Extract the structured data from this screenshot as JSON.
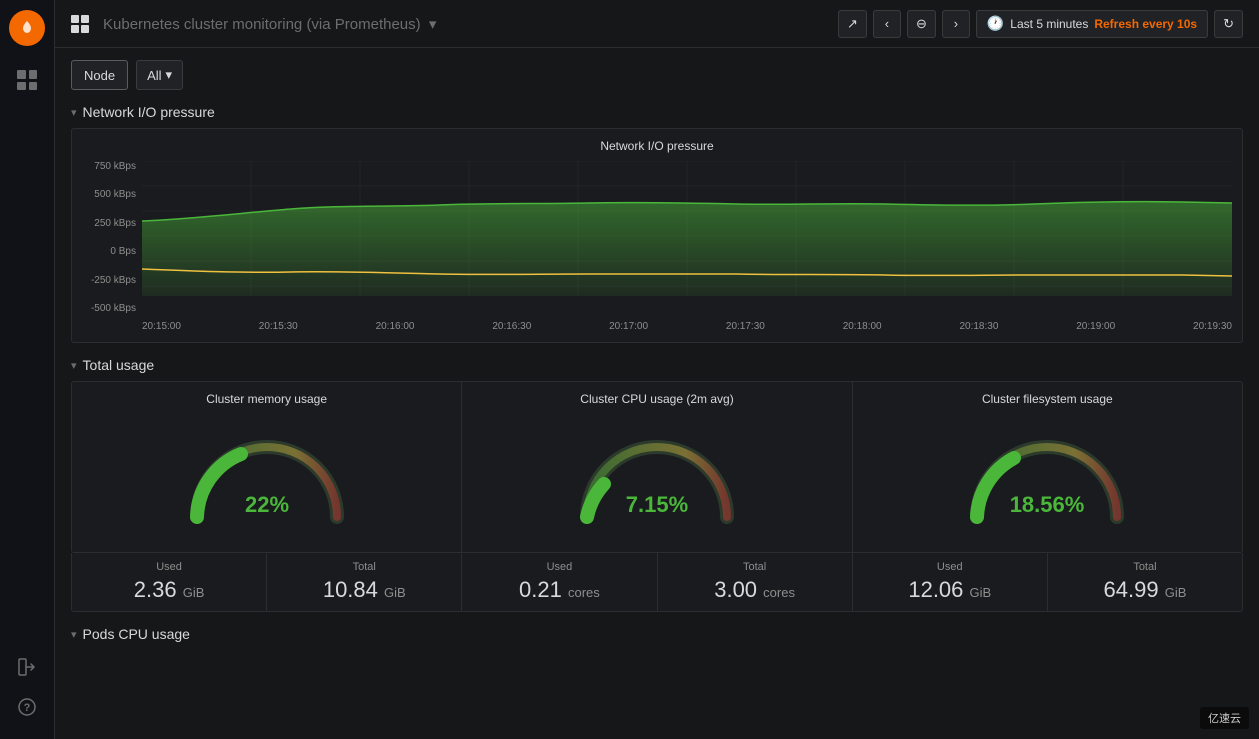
{
  "sidebar": {
    "logo": "🔥",
    "items": []
  },
  "topbar": {
    "title": "Kubernetes cluster monitoring (via Prometheus)",
    "title_suffix": "▾",
    "share_icon": "↗",
    "back_icon": "‹",
    "zoom_out_icon": "⊖",
    "forward_icon": "›",
    "time_range": "Last 5 minutes",
    "refresh_label": "Refresh every 10s",
    "sync_icon": "↻"
  },
  "filters": {
    "node_label": "Node",
    "all_label": "All",
    "all_suffix": "▾"
  },
  "network_section": {
    "collapse_icon": "▾",
    "title": "Network I/O pressure",
    "chart_title": "Network I/O pressure",
    "y_labels": [
      "750 kBps",
      "500 kBps",
      "250 kBps",
      "0 Bps",
      "-250 kBps",
      "-500 kBps"
    ],
    "x_labels": [
      "20:15:00",
      "20:15:30",
      "20:16:00",
      "20:16:30",
      "20:17:00",
      "20:17:30",
      "20:18:00",
      "20:18:30",
      "20:19:00",
      "20:19:30"
    ]
  },
  "total_section": {
    "collapse_icon": "▾",
    "title": "Total usage",
    "gauges": [
      {
        "title": "Cluster memory usage",
        "percent": "22%",
        "color": "#4ab73a"
      },
      {
        "title": "Cluster CPU usage (2m avg)",
        "percent": "7.15%",
        "color": "#4ab73a"
      },
      {
        "title": "Cluster filesystem usage",
        "percent": "18.56%",
        "color": "#4ab73a"
      }
    ],
    "stats": [
      {
        "label": "Used",
        "value": "2.36",
        "unit": "GiB"
      },
      {
        "label": "Total",
        "value": "10.84",
        "unit": "GiB"
      },
      {
        "label": "Used",
        "value": "0.21",
        "unit": "cores"
      },
      {
        "label": "Total",
        "value": "3.00",
        "unit": "cores"
      },
      {
        "label": "Used",
        "value": "12.06",
        "unit": "GiB"
      },
      {
        "label": "Total",
        "value": "64.99",
        "unit": "GiB"
      }
    ]
  },
  "pods_section": {
    "collapse_icon": "▾",
    "title": "Pods CPU usage"
  },
  "watermark": "亿速云"
}
